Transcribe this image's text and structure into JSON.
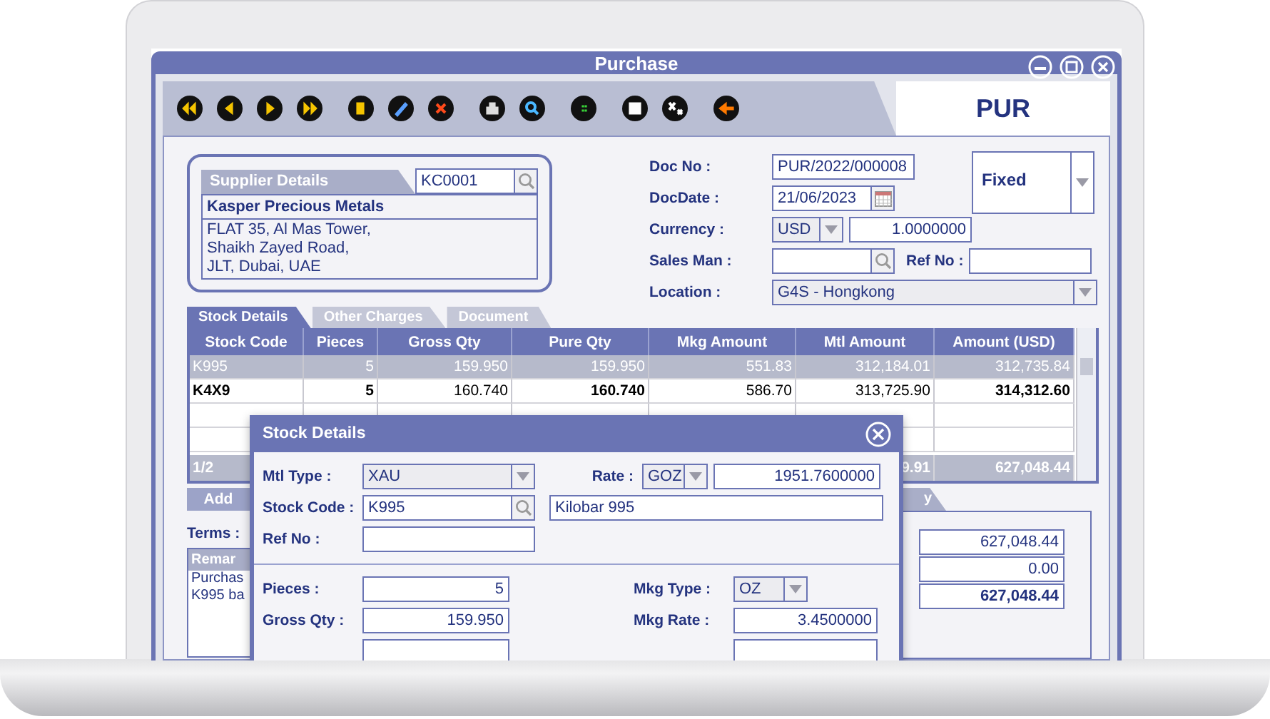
{
  "window": {
    "title": "Purchase"
  },
  "doc_code": "PUR",
  "supplier": {
    "tab": "Supplier Details",
    "code": "KC0001",
    "name": "Kasper Precious Metals",
    "address": [
      "FLAT 35, Al Mas Tower,",
      "Shaikh Zayed Road,",
      "JLT, Dubai, UAE"
    ]
  },
  "doc_no": {
    "label": "Doc No :",
    "value": "PUR/2022/000008"
  },
  "doc_date": {
    "label": "DocDate :",
    "value": "21/06/2023"
  },
  "currency": {
    "label": "Currency :",
    "value": "USD",
    "rate": "1.0000000"
  },
  "sales_man": {
    "label": "Sales Man :"
  },
  "ref_no": {
    "label": "Ref No :"
  },
  "location": {
    "label": "Location :",
    "value": "G4S - Hongkong"
  },
  "rate_mode": {
    "value": "Fixed"
  },
  "tabs": [
    {
      "label": "Stock Details",
      "selected": true
    },
    {
      "label": "Other Charges",
      "selected": false
    },
    {
      "label": "Document",
      "selected": false
    }
  ],
  "table": {
    "columns": [
      {
        "label": "Stock Code",
        "bold": true
      },
      {
        "label": "Pieces",
        "bold": true
      },
      {
        "label": "Gross Qty",
        "bold": false
      },
      {
        "label": "Pure Qty",
        "bold": true
      },
      {
        "label": "Mkg Amount",
        "bold": false
      },
      {
        "label": "Mtl Amount",
        "bold": false
      },
      {
        "label": "Amount (USD)",
        "bold": true
      }
    ],
    "rows": [
      {
        "selected": true,
        "cells": [
          "K995",
          "5",
          "159.950",
          "159.950",
          "551.83",
          "312,184.01",
          "312,735.84"
        ]
      },
      {
        "selected": false,
        "cells": [
          "K4X9",
          "5",
          "160.740",
          "160.740",
          "586.70",
          "313,725.90",
          "314,312.60"
        ]
      }
    ],
    "footer": {
      "count": "1/2",
      "mtl_amount": "9.91",
      "amount": "627,048.44"
    }
  },
  "add_button": "Add",
  "terms_label": "Terms :",
  "remarks": {
    "title": "Remar",
    "lines": [
      "Purchas",
      "K995 ba"
    ]
  },
  "summary_tab": "y",
  "summary": [
    {
      "kind": "amount",
      "value": "627,048.44"
    },
    {
      "kind": "amount",
      "value": "0.00"
    },
    {
      "kind": "total",
      "value": "627,048.44"
    }
  ],
  "dialog": {
    "title": "Stock Details",
    "mtl_type": {
      "label": "Mtl Type :",
      "value": "XAU"
    },
    "rate": {
      "label": "Rate :",
      "unit": "GOZ",
      "value": "1951.7600000"
    },
    "stock_code": {
      "label": "Stock Code :",
      "value": "K995",
      "description": "Kilobar 995"
    },
    "ref_no": {
      "label": "Ref No :"
    },
    "pieces": {
      "label": "Pieces :",
      "value": "5"
    },
    "mkg_type": {
      "label": "Mkg Type :",
      "value": "OZ"
    },
    "gross_qty": {
      "label": "Gross Qty :",
      "value": "159.950"
    },
    "mkg_rate": {
      "label": "Mkg Rate :",
      "value": "3.4500000"
    }
  }
}
